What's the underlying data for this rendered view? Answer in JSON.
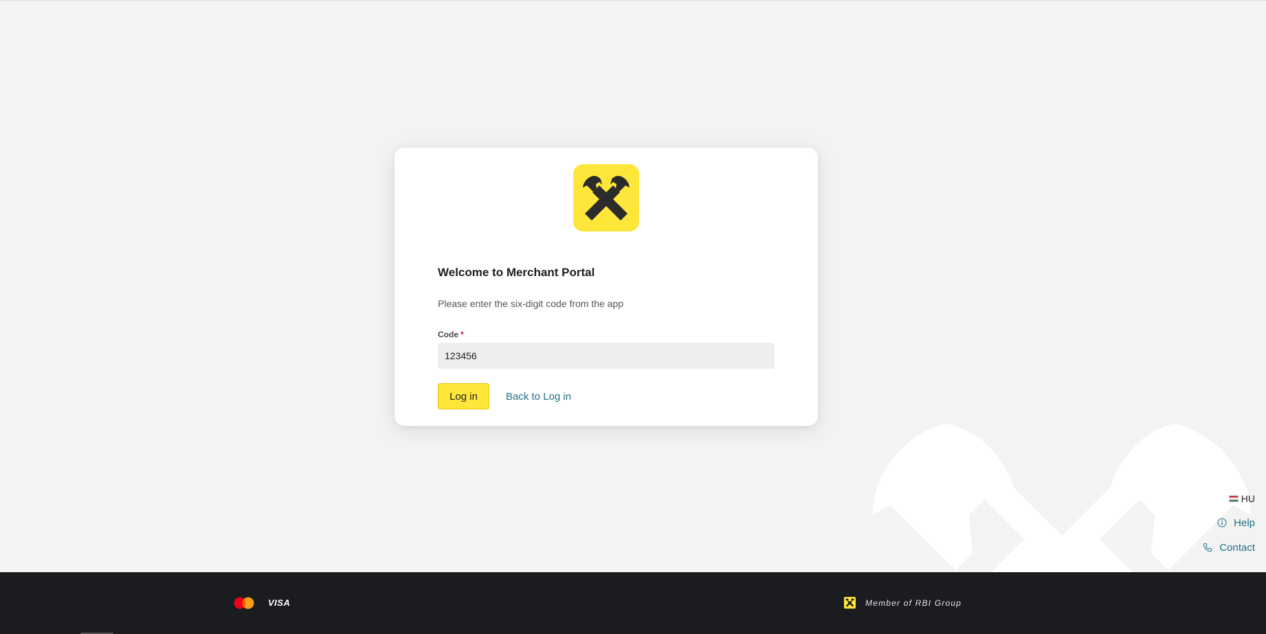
{
  "login": {
    "title": "Welcome to Merchant Portal",
    "subtitle": "Please enter the six-digit code from the app",
    "code_label": "Code",
    "code_required_mark": "*",
    "code_value": "123456",
    "login_button": "Log in",
    "back_link": "Back to Log in"
  },
  "side_links": {
    "language": "HU",
    "help": "Help",
    "contact": "Contact"
  },
  "footer": {
    "card_brand_visa": "VISA",
    "member_text": "Member of RBI Group"
  },
  "icons": {
    "logo": "raiffeisen-crossed-horses-icon",
    "language": "hungarian-flag-icon",
    "help": "info-icon",
    "contact": "phone-icon",
    "mastercard": "mastercard-icon",
    "rbi": "raiffeisen-small-icon"
  },
  "colors": {
    "brand_yellow": "#fee73a",
    "link": "#1f6f85",
    "footer_bg": "#1b1c20",
    "page_bg": "#f3f3f3"
  }
}
